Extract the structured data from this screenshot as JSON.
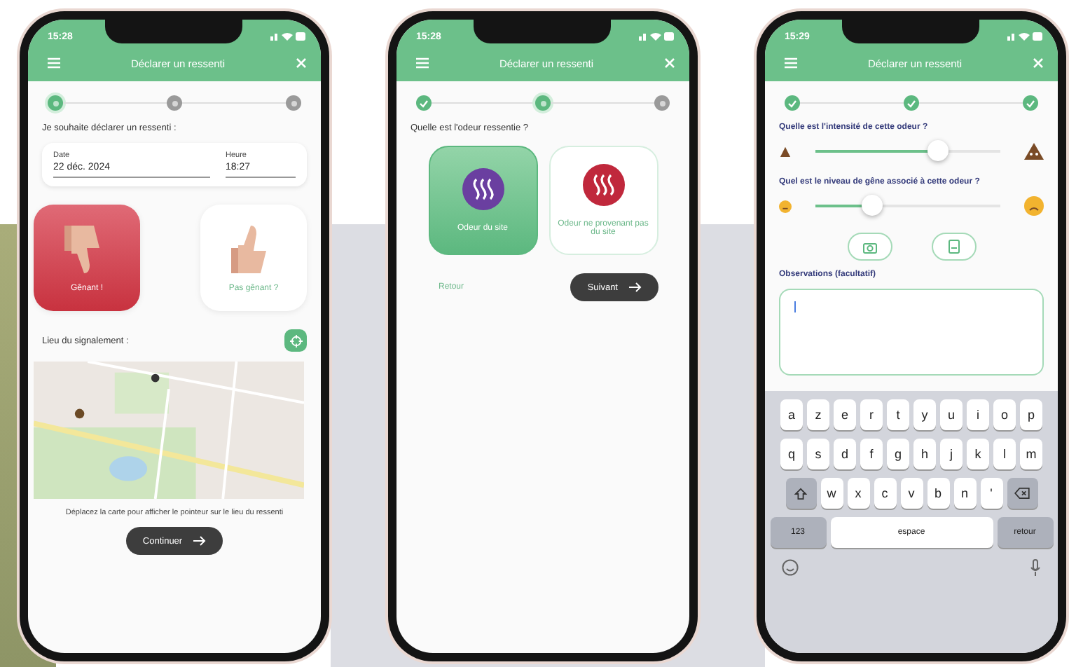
{
  "report_screen": {
    "status_bar": {
      "time": "15:28"
    },
    "header": {
      "title": "Déclarer un ressenti"
    },
    "steps": [
      {
        "done": false,
        "current": true
      },
      {
        "done": false,
        "current": false
      },
      {
        "done": false,
        "current": false
      }
    ],
    "prompt": "Je souhaite déclarer un ressenti :",
    "date_field": {
      "label": "Date",
      "value": "22 déc. 2024"
    },
    "time_field": {
      "label": "Heure",
      "value": "18:27"
    },
    "choices": [
      {
        "kind": "thumbs-down",
        "label": "Gênant !",
        "selected": true
      },
      {
        "kind": "thumbs-up",
        "label": "Pas gênant ?",
        "selected": false
      }
    ],
    "location_label": "Lieu du signalement :",
    "map_hint": "Déplacez la carte pour afficher le pointeur sur le lieu du ressenti",
    "next_button": "Continuer"
  },
  "odor_screen": {
    "status_bar": {
      "time": "15:28"
    },
    "header": {
      "title": "Déclarer un ressenti"
    },
    "steps": [
      {
        "done": true,
        "current": false
      },
      {
        "done": false,
        "current": true
      },
      {
        "done": false,
        "current": false
      }
    ],
    "question": "Quelle est l'odeur ressentie ?",
    "choices": [
      {
        "label": "Odeur du site",
        "color": "#6a3fa0",
        "selected": true
      },
      {
        "label": "Odeur ne provenant pas du site",
        "color": "#c0283c",
        "selected": false
      }
    ],
    "back_link": "Retour",
    "next_button": "Suivant"
  },
  "intensity_screen": {
    "status_bar": {
      "time": "15:29"
    },
    "header": {
      "title": "Déclarer un ressenti"
    },
    "steps": [
      {
        "done": true,
        "current": false
      },
      {
        "done": true,
        "current": false
      },
      {
        "done": true,
        "current": false
      }
    ],
    "sliders": [
      {
        "question": "Quelle est l'intensité de cette odeur ?",
        "kind": "intensity",
        "level": 0.66
      },
      {
        "question": "Quel est le niveau de gêne associé à cette odeur ?",
        "kind": "discomfort",
        "level": 0.3
      }
    ],
    "observations_label": "Observations (facultatif)",
    "keyboard": {
      "rows": [
        [
          "a",
          "z",
          "e",
          "r",
          "t",
          "y",
          "u",
          "i",
          "o",
          "p"
        ],
        [
          "q",
          "s",
          "d",
          "f",
          "g",
          "h",
          "j",
          "k",
          "l",
          "m"
        ],
        [
          "w",
          "x",
          "c",
          "v",
          "b",
          "n",
          "'"
        ]
      ],
      "numbers_key": "123",
      "space_key": "espace",
      "return_key": "retour"
    }
  }
}
